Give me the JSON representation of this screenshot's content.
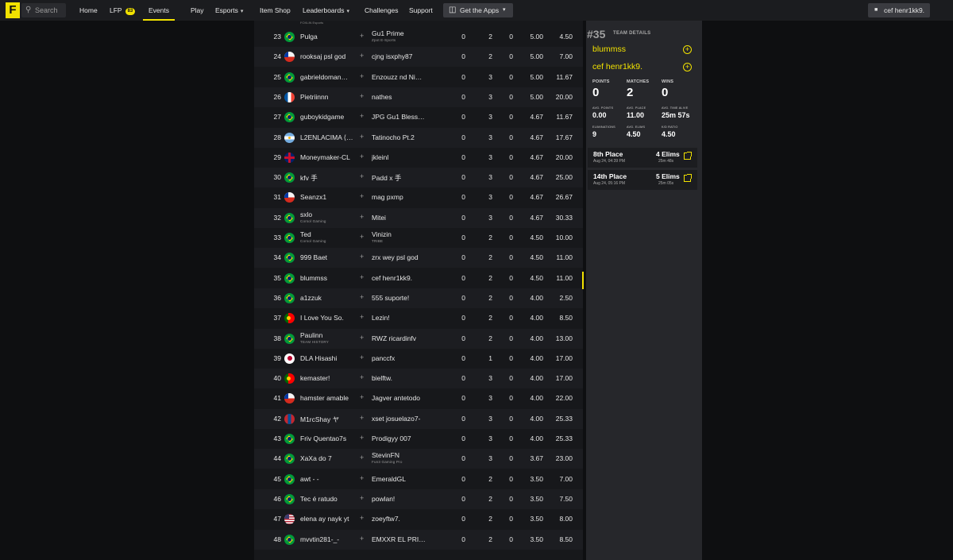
{
  "nav": {
    "logo": "F",
    "search_placeholder": "Search",
    "items": [
      {
        "label": "Home"
      },
      {
        "label": "LFP",
        "badge": "83"
      },
      {
        "label": "Events"
      },
      {
        "label": "Play"
      },
      {
        "label": "Esports"
      },
      {
        "label": "Item Shop"
      },
      {
        "label": "Leaderboards"
      },
      {
        "label": "Challenges"
      },
      {
        "label": "Support"
      }
    ],
    "get_apps": "Get the Apps",
    "user": "cef henr1kk9."
  },
  "table": {
    "top_hidden_sub": "FOXLIN Esports",
    "rows": [
      {
        "rank": "23",
        "flag": "br",
        "p1": "Pulga",
        "p1_sub": "",
        "p2": "Gu1 Prime",
        "p2_sub": "Zpot E-Sports",
        "a": "0",
        "b": "2",
        "c": "0",
        "d": "5.00",
        "e": "4.50"
      },
      {
        "rank": "24",
        "flag": "cl",
        "p1": "rooksaj psl god",
        "p1_sub": "",
        "p2": "cjng isxphy87",
        "p2_sub": "",
        "a": "0",
        "b": "2",
        "c": "0",
        "d": "5.00",
        "e": "7.00"
      },
      {
        "rank": "25",
        "flag": "br",
        "p1": "gabrieldoman…",
        "p1_sub": "",
        "p2": "Enzouzz nd Ni…",
        "p2_sub": "",
        "a": "0",
        "b": "3",
        "c": "0",
        "d": "5.00",
        "e": "11.67"
      },
      {
        "rank": "26",
        "flag": "fr",
        "p1": "Pietriinnn",
        "p1_sub": "",
        "p2": "nathes",
        "p2_sub": "",
        "a": "0",
        "b": "3",
        "c": "0",
        "d": "5.00",
        "e": "20.00"
      },
      {
        "rank": "27",
        "flag": "br",
        "p1": "guboykidgame",
        "p1_sub": "",
        "p2": "JPG Gu1 Bless…",
        "p2_sub": "",
        "a": "0",
        "b": "3",
        "c": "0",
        "d": "4.67",
        "e": "11.67"
      },
      {
        "rank": "28",
        "flag": "ar",
        "p1": "L2ENLACIMA ⟨…",
        "p1_sub": "",
        "p2": "Tatinocho Pt.2",
        "p2_sub": "",
        "a": "0",
        "b": "3",
        "c": "0",
        "d": "4.67",
        "e": "17.67"
      },
      {
        "rank": "29",
        "flag": "gb",
        "p1": "Moneymaker-CL",
        "p1_sub": "",
        "p2": "jkleinl",
        "p2_sub": "",
        "a": "0",
        "b": "3",
        "c": "0",
        "d": "4.67",
        "e": "20.00"
      },
      {
        "rank": "30",
        "flag": "br",
        "p1": "kfv 手",
        "p1_sub": "",
        "p2": "Padd x 手",
        "p2_sub": "",
        "a": "0",
        "b": "3",
        "c": "0",
        "d": "4.67",
        "e": "25.00"
      },
      {
        "rank": "31",
        "flag": "cl",
        "p1": "Seanzx1",
        "p1_sub": "",
        "p2": "mag pxmp",
        "p2_sub": "",
        "a": "0",
        "b": "3",
        "c": "0",
        "d": "4.67",
        "e": "26.67"
      },
      {
        "rank": "32",
        "flag": "br",
        "p1": "sxlo",
        "p1_sub": "Corsol Gaming",
        "p2": "Mitei",
        "p2_sub": "",
        "a": "0",
        "b": "3",
        "c": "0",
        "d": "4.67",
        "e": "30.33"
      },
      {
        "rank": "33",
        "flag": "br",
        "p1": "Ted",
        "p1_sub": "Corsol Gaming",
        "p2": "Vinizin",
        "p2_sub": "TRIBE",
        "a": "0",
        "b": "2",
        "c": "0",
        "d": "4.50",
        "e": "10.00"
      },
      {
        "rank": "34",
        "flag": "br",
        "p1": "999 Baet",
        "p1_sub": "",
        "p2": "zrx wey psl god",
        "p2_sub": "",
        "a": "0",
        "b": "2",
        "c": "0",
        "d": "4.50",
        "e": "11.00"
      },
      {
        "rank": "35",
        "flag": "br",
        "p1": "blummss",
        "p1_sub": "",
        "p2": "cef henr1kk9.",
        "p2_sub": "",
        "a": "0",
        "b": "2",
        "c": "0",
        "d": "4.50",
        "e": "11.00"
      },
      {
        "rank": "36",
        "flag": "br",
        "p1": "a1zzuk",
        "p1_sub": "",
        "p2": "555 suporte!",
        "p2_sub": "",
        "a": "0",
        "b": "2",
        "c": "0",
        "d": "4.00",
        "e": "2.50"
      },
      {
        "rank": "37",
        "flag": "pt",
        "p1": "I Love You So.",
        "p1_sub": "",
        "p2": "Lezin!",
        "p2_sub": "",
        "a": "0",
        "b": "2",
        "c": "0",
        "d": "4.00",
        "e": "8.50"
      },
      {
        "rank": "38",
        "flag": "br",
        "p1": "Paulinn",
        "p1_sub": "TEAM HISTORY",
        "p2": "RWZ ricardinfv",
        "p2_sub": "",
        "a": "0",
        "b": "2",
        "c": "0",
        "d": "4.00",
        "e": "13.00"
      },
      {
        "rank": "39",
        "flag": "jp",
        "p1": "DLA Hisashi",
        "p1_sub": "",
        "p2": "panccfx",
        "p2_sub": "",
        "a": "0",
        "b": "1",
        "c": "0",
        "d": "4.00",
        "e": "17.00"
      },
      {
        "rank": "40",
        "flag": "pt",
        "p1": "kemaster!",
        "p1_sub": "",
        "p2": "bielftw.",
        "p2_sub": "",
        "a": "0",
        "b": "3",
        "c": "0",
        "d": "4.00",
        "e": "17.00"
      },
      {
        "rank": "41",
        "flag": "cl",
        "p1": "hamster amable",
        "p1_sub": "",
        "p2": "Jagver antetodo",
        "p2_sub": "",
        "a": "0",
        "b": "3",
        "c": "0",
        "d": "4.00",
        "e": "22.00"
      },
      {
        "rank": "42",
        "flag": "mn",
        "p1": "M1rcShay ヤ",
        "p1_sub": "",
        "p2": "xset josuelazo7-",
        "p2_sub": "",
        "a": "0",
        "b": "3",
        "c": "0",
        "d": "4.00",
        "e": "25.33"
      },
      {
        "rank": "43",
        "flag": "br",
        "p1": "Friv Quentao7s",
        "p1_sub": "",
        "p2": "Prodigyy 007",
        "p2_sub": "",
        "a": "0",
        "b": "3",
        "c": "0",
        "d": "4.00",
        "e": "25.33"
      },
      {
        "rank": "44",
        "flag": "br",
        "p1": "XaXa do 7",
        "p1_sub": "",
        "p2": "StevinFN",
        "p2_sub": "Fun3 Gaming Pro",
        "a": "0",
        "b": "3",
        "c": "0",
        "d": "3.67",
        "e": "23.00"
      },
      {
        "rank": "45",
        "flag": "br",
        "p1": "awt - -",
        "p1_sub": "",
        "p2": "EmeraldGL",
        "p2_sub": "",
        "a": "0",
        "b": "2",
        "c": "0",
        "d": "3.50",
        "e": "7.00"
      },
      {
        "rank": "46",
        "flag": "br",
        "p1": "Tec é ratudo",
        "p1_sub": "",
        "p2": "powlan!",
        "p2_sub": "",
        "a": "0",
        "b": "2",
        "c": "0",
        "d": "3.50",
        "e": "7.50"
      },
      {
        "rank": "47",
        "flag": "us",
        "p1": "elena ay nayk yt",
        "p1_sub": "",
        "p2": "zoeyftw7.",
        "p2_sub": "",
        "a": "0",
        "b": "2",
        "c": "0",
        "d": "3.50",
        "e": "8.00"
      },
      {
        "rank": "48",
        "flag": "br",
        "p1": "mvvtin281-_-",
        "p1_sub": "",
        "p2": "EMXXR EL PRI…",
        "p2_sub": "",
        "a": "0",
        "b": "2",
        "c": "0",
        "d": "3.50",
        "e": "8.50"
      }
    ]
  },
  "panel": {
    "rank": "#35",
    "title": "TEAM DETAILS",
    "members": [
      "blummss",
      "cef henr1kk9."
    ],
    "stats": [
      {
        "label": "POINTS",
        "value": "0"
      },
      {
        "label": "MATCHES",
        "value": "2"
      },
      {
        "label": "WINS",
        "value": "0"
      }
    ],
    "metrics": [
      {
        "label": "AVG. POINTS",
        "value": "0.00"
      },
      {
        "label": "AVG. PLACE",
        "value": "11.00"
      },
      {
        "label": "AVG. TIME ALIVE",
        "value": "25m 57s"
      },
      {
        "label": "ELIMINATIONS",
        "value": "9"
      },
      {
        "label": "AVG. ELIMS",
        "value": "4.50"
      },
      {
        "label": "K/D RATIO",
        "value": "4.50"
      }
    ],
    "matches": [
      {
        "place": "8th Place",
        "date": "Aug 24, 04:39 PM",
        "elims": "4 Elims",
        "time": "25m 48s"
      },
      {
        "place": "14th Place",
        "date": "Aug 24, 05:16 PM",
        "elims": "5 Elims",
        "time": "25m 05s"
      }
    ]
  }
}
